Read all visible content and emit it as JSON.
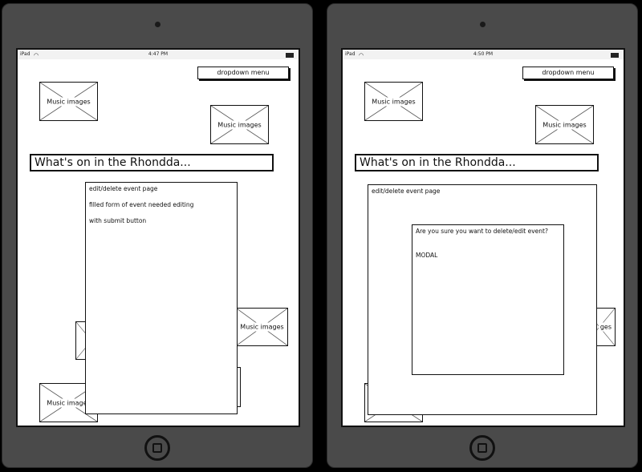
{
  "left_mockup": {
    "status": {
      "carrier": "iPad",
      "time": "4:47 PM"
    },
    "dropdown_label": "dropdown menu",
    "image_label": "Music images",
    "page_title": "What's on in the Rhondda...",
    "panel": {
      "heading": "edit/delete event page",
      "line1": "filled form of event needed editing",
      "line2": "with submit button"
    }
  },
  "right_mockup": {
    "status": {
      "carrier": "iPad",
      "time": "4:50 PM"
    },
    "dropdown_label": "dropdown menu",
    "image_label": "Music images",
    "partial_image_label": "ges",
    "page_title": "What's on in the Rhondda...",
    "panel_heading": "edit/delete event page",
    "modal": {
      "question": "Are you sure you want to delete/edit event?",
      "label": "MODAL"
    }
  }
}
